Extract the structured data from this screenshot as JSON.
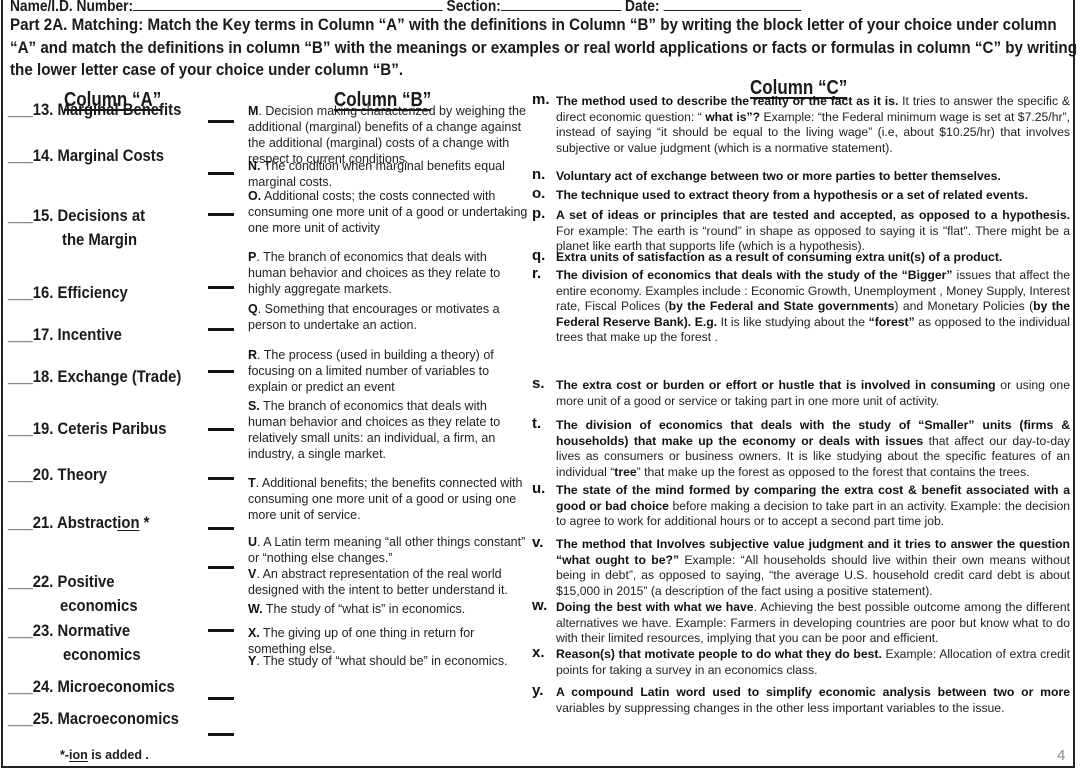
{
  "header": {
    "name_label": "Name/I.D. Number:",
    "section_label": "Section:",
    "date_label": "Date:"
  },
  "instructions": "Part 2A. Matching: Match the Key terms in Column “A” with the definitions in Column “B” by writing the block letter of your choice under column “A” and match the definitions in column “B” with the meanings or examples or real world applications or facts or formulas in column “C” by writing the lower letter case of your choice under column “B”.",
  "columns": {
    "a_title": "Column “A”",
    "b_title": "Column “B”",
    "c_title": "Column “C”"
  },
  "column_a": [
    {
      "blank": "___",
      "number": "13.",
      "term": "Marginal Benefits"
    },
    {
      "blank": "___",
      "number": "14.",
      "term": "Marginal Costs"
    },
    {
      "blank": "___",
      "number": "15.",
      "term": "Decisions at",
      "cont": "the Margin"
    },
    {
      "blank": "___",
      "number": "16.",
      "term": "Efficiency"
    },
    {
      "blank": "___",
      "number": "17.",
      "term": " Incentive"
    },
    {
      "blank": "___",
      "number": "18.",
      "term": " Exchange (Trade)"
    },
    {
      "blank": "___",
      "number": "19.",
      "term": "Ceteris Paribus"
    },
    {
      "blank": "___",
      "number": "20.",
      "term": "Theory"
    },
    {
      "blank": "___",
      "number": "21.",
      "term": "Abstract",
      "term_underlined": "ion",
      "term_suffix": " *"
    },
    {
      "blank": "___",
      "number": "22.",
      "term": "Positive",
      "cont": "economics"
    },
    {
      "blank": "___",
      "number": "23.",
      "term": "Normative",
      "cont": "economics"
    },
    {
      "blank": "___",
      "number": "24.",
      "term": "Microeconomics"
    },
    {
      "blank": "___",
      "number": "25.",
      "term": "Macroeconomics"
    }
  ],
  "footnote": {
    "prefix": "*-",
    "underlined": "ion",
    "suffix": " is added ."
  },
  "column_b": [
    {
      "letter": "M",
      "sep": ". ",
      "text": "Decision making characterized by weighing the additional (marginal) benefits of a change against the additional (marginal) costs of a change with respect to current conditions."
    },
    {
      "letter": "N.",
      "sep": " ",
      "text": "The condition when marginal benefits equal marginal costs."
    },
    {
      "letter": "O.",
      "sep": " ",
      "text": "Additional costs; the costs connected with consuming one more unit of a good or undertaking one more unit of activity"
    },
    {
      "letter": "P",
      "sep": ". ",
      "text": "The branch of economics that deals with human behavior and choices as they relate to highly aggregate markets."
    },
    {
      "letter": "Q",
      "sep": ". ",
      "text": "Something that encourages or motivates a person to undertake an action."
    },
    {
      "letter": "R",
      "sep": ". ",
      "text": "The process (used in building a theory) of focusing on a limited number of variables to explain or predict an event"
    },
    {
      "letter": "S.",
      "sep": " ",
      "text": "The branch of economics that deals with human behavior and choices as they relate to relatively small units: an individual, a firm, an industry, a single market."
    },
    {
      "letter": "T",
      "sep": ". ",
      "text": "Additional benefits; the benefits connected with consuming one more unit of a good or using one more unit of service."
    },
    {
      "letter": "U",
      "sep": ". ",
      "text": "A Latin term meaning “all other things constant” or “nothing else changes.”"
    },
    {
      "letter": "V",
      "sep": ". ",
      "text": "An abstract representation of the real world designed with the intent to better understand it."
    },
    {
      "letter": "W.",
      "sep": "  ",
      "text": "The study of “what is” in economics."
    },
    {
      "letter": "X.",
      "sep": " ",
      "text": "The giving up of one thing in return for something else."
    },
    {
      "letter": "Y",
      "sep": ". ",
      "text": "The study of “what should be” in economics."
    }
  ],
  "column_c": [
    {
      "letter": "m.",
      "segments": [
        {
          "b": true,
          "t": "The method used to describe the reality or the fact as it is."
        },
        {
          "b": false,
          "t": " It tries to answer the specific & direct economic question: “"
        },
        {
          "b": true,
          "t": " what is”?"
        },
        {
          "b": false,
          "t": " Example: “the Federal minimum wage is set at $7.25/hr”, instead of saying “it should be equal to the living wage” (i.e, about $10.25/hr) that involves subjective or value judgment (which is a normative statement)."
        }
      ]
    },
    {
      "letter": "n.",
      "segments": [
        {
          "b": true,
          "t": "Voluntary act of exchange between two or more parties to better themselves."
        }
      ]
    },
    {
      "letter": "o.",
      "segments": [
        {
          "b": true,
          "t": "The technique used to extract theory from a hypothesis or a set of related events."
        }
      ]
    },
    {
      "letter": "p.",
      "segments": [
        {
          "b": true,
          "t": "A set of ideas or principles that are tested and accepted, as opposed to a hypothesis."
        },
        {
          "b": false,
          "t": " For example: The earth is “round” in shape as opposed to saying it is \"flat\". There might be a planet like earth that supports life (which is a hypothesis)."
        }
      ]
    },
    {
      "letter": "q.",
      "segments": [
        {
          "b": true,
          "t": "Extra units of satisfaction as a result of consuming extra unit(s) of a product."
        }
      ]
    },
    {
      "letter": "r.",
      "segments": [
        {
          "b": true,
          "t": "The division of economics that deals with the study of the “Bigger”"
        },
        {
          "b": false,
          "t": " issues that affect the entire economy. Examples include : Economic Growth, Unemployment , Money Supply, Interest rate, Fiscal Polices ("
        },
        {
          "b": true,
          "t": "by the Federal and State governments"
        },
        {
          "b": false,
          "t": ") and Monetary Policies ("
        },
        {
          "b": true,
          "t": "by the Federal Reserve Bank). E.g."
        },
        {
          "b": false,
          "t": " It is like studying about the "
        },
        {
          "b": true,
          "t": "“forest”"
        },
        {
          "b": false,
          "t": " as opposed to the individual trees that make up the forest ."
        }
      ]
    },
    {
      "letter": "s.",
      "segments": [
        {
          "b": true,
          "t": "The extra cost or burden or effort or hustle that is involved in consuming"
        },
        {
          "b": false,
          "t": " or using one more unit of a good or service or taking part in one more unit of activity."
        }
      ]
    },
    {
      "letter": "t.",
      "segments": [
        {
          "b": true,
          "t": "The division of economics that deals with the study of “Smaller” units (firms & households) that make up the economy or deals with issues"
        },
        {
          "b": false,
          "t": " that affect our day-to-day lives as consumers or business owners. It is like studying about the specific features of an individual “"
        },
        {
          "b": true,
          "t": "tree"
        },
        {
          "b": false,
          "t": "” that make up the forest as opposed to the forest that contains the trees."
        }
      ]
    },
    {
      "letter": "u.",
      "segments": [
        {
          "b": true,
          "t": "The state of the mind formed by comparing the extra cost & benefit associated with a good or bad choice"
        },
        {
          "b": false,
          "t": " before making a decision to take part in an activity. Example: the decision to agree to work for additional hours or to accept a second part time job."
        }
      ]
    },
    {
      "letter": "v.",
      "segments": [
        {
          "b": true,
          "t": "The method that Involves subjective value judgment and it tries to answer the question “what ought to be?”"
        },
        {
          "b": false,
          "t": " Example: “All households should live within their own means without being in debt”, as opposed to saying, “the average U.S. household credit card debt is about $15,000 in 2015” (a description of the fact using a positive statement)."
        }
      ]
    },
    {
      "letter": "w.",
      "segments": [
        {
          "b": true,
          "t": "Doing the best with what we have"
        },
        {
          "b": false,
          "t": ". Achieving the best possible outcome among the different alternatives we have. Example: Farmers in developing countries are poor but know what to do with their limited resources, implying that you can be poor and efficient."
        }
      ]
    },
    {
      "letter": "x.",
      "segments": [
        {
          "b": true,
          "t": "Reason(s) that motivate people to do what they do best."
        },
        {
          "b": false,
          "t": " Example: Allocation of extra credit points for taking a survey in an economics class."
        }
      ]
    },
    {
      "letter": "y.",
      "segments": [
        {
          "b": true,
          "t": "A compound Latin word used to simplify economic analysis between two or more"
        },
        {
          "b": false,
          "t": " variables by suppressing changes in the other less important variables to the issue."
        }
      ]
    }
  ],
  "page_number": "4"
}
